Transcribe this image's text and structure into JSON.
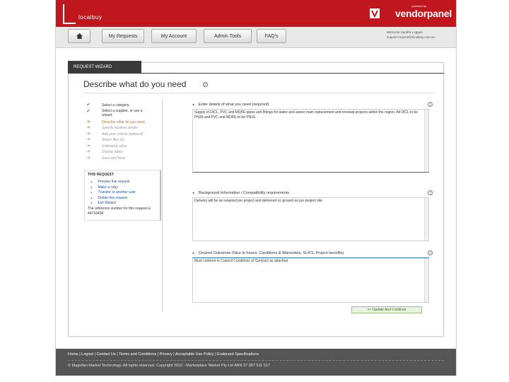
{
  "header": {
    "brand_logo_text": "localbuy",
    "vendor_small": "powered by",
    "vendor_logo": "vendorpanel",
    "colors": {
      "brand_red": "#c0161e"
    }
  },
  "nav": {
    "home_icon": "home-icon",
    "items": [
      "My Requests",
      "My Account",
      "Admin Tools",
      "FAQ's"
    ],
    "user_line1": "Welcome Sandra Logged",
    "user_line2": "support.request@localbuy.com.au"
  },
  "wizard": {
    "tab_label": "REQUEST WIZARD",
    "title": "Describe what do you need",
    "help_glyph": "?",
    "steps": [
      {
        "label": "Select a category",
        "state": "done"
      },
      {
        "label": "Select a supplier, or use a wizard",
        "state": "done",
        "two_line": true
      },
      {
        "label": "Describe what do you need",
        "state": "current"
      },
      {
        "label": "Specify location details",
        "state": "todo"
      },
      {
        "label": "Add your criteria (optional)",
        "state": "todo"
      },
      {
        "label": "Attach files (0)",
        "state": "todo"
      },
      {
        "label": "Estimated value",
        "state": "todo"
      },
      {
        "label": "Display dates",
        "state": "todo"
      },
      {
        "label": "Save and Next",
        "state": "todo"
      }
    ],
    "request_box": {
      "title": "THIS REQUEST",
      "actions": [
        "Preview this request",
        "Make a copy",
        "Transfer to another user",
        "Delete this request",
        "Exit Wizard"
      ],
      "note": "The reference number for this request is 44716438"
    }
  },
  "fields": [
    {
      "heading": "Enter details of what you need (required)",
      "text": "Supply of DICL, PVC and MDPE pipes and fittings for water and sewer main replacement and renewal projects within the region. All DICL to be PN35 and PVC and MDPE to be PN16."
    },
    {
      "heading": "Background Information / Compatibility requirements",
      "text": "Delivery will be as required per project and delivered on ground as per project site."
    },
    {
      "heading": "Desired Outcomes (Nice to haves, Conditions & Warranties, SLA'S, Project benefits)",
      "text": "Must conform to Council Conditions of Contract as attached."
    }
  ],
  "submit_label": ">> Update And Continue",
  "footer": {
    "links": "Home | Logout | Contact Us | Terms and Conditions | Privacy | Acceptable Use Policy | Endorsed Specifications",
    "copyright": "© Magellan Market Technology. All rights reserved. Copyright 2010 - Marketplace Market Pty Ltd ABN 37 087 511 517"
  }
}
